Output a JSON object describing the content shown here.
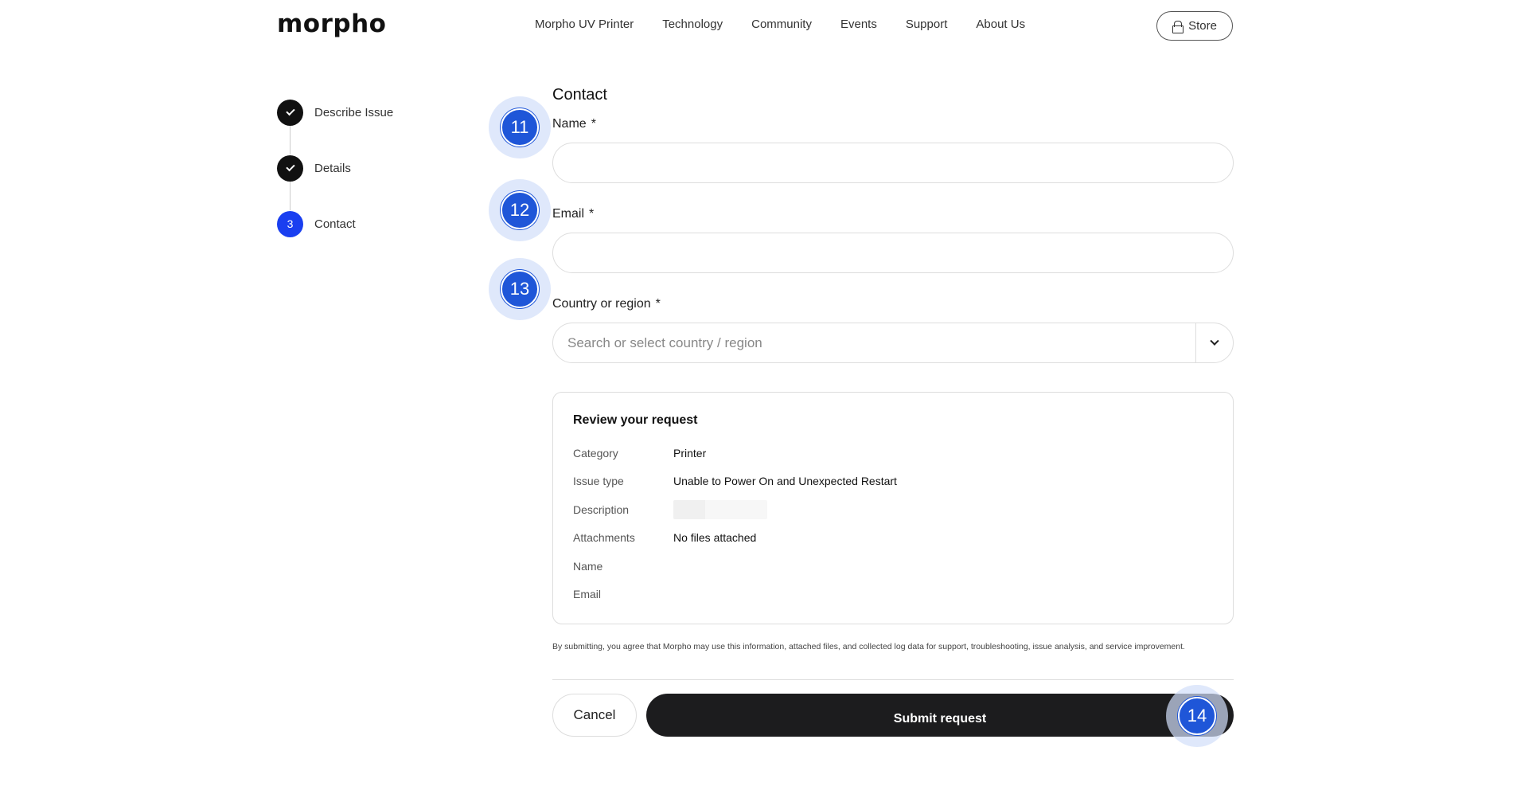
{
  "header": {
    "logo": "morpho",
    "nav": [
      "Morpho UV Printer",
      "Technology",
      "Community",
      "Events",
      "Support",
      "About Us"
    ],
    "store_label": "Store"
  },
  "steps": [
    {
      "number": "",
      "label": "Describe Issue",
      "status": "done"
    },
    {
      "number": "",
      "label": "Details",
      "status": "done"
    },
    {
      "number": "3",
      "label": "Contact",
      "status": "active"
    }
  ],
  "form": {
    "title": "Contact",
    "name_label": "Name",
    "email_label": "Email",
    "country_label": "Country or region",
    "required_mark": "*",
    "name_value": "",
    "email_value": "",
    "country_placeholder": "Search or select country / region"
  },
  "review": {
    "title": "Review your request",
    "rows": [
      {
        "key": "Category",
        "value": "Printer"
      },
      {
        "key": "Issue type",
        "value": "Unable to Power On and Unexpected Restart"
      },
      {
        "key": "Description",
        "value": ""
      },
      {
        "key": "Attachments",
        "value": "No files attached"
      },
      {
        "key": "Name",
        "value": ""
      },
      {
        "key": "Email",
        "value": ""
      }
    ]
  },
  "consent": "By submitting, you agree that Morpho may use this information, attached files, and collected log data for support, troubleshooting, issue analysis, and service improvement.",
  "actions": {
    "cancel_label": "Cancel",
    "submit_label": "Submit request"
  },
  "badges": [
    "11",
    "12",
    "13",
    "14"
  ],
  "colors": {
    "accent": "#1a3ff0",
    "badge": "#1f56d8",
    "submit_bg": "#1c1c1e"
  }
}
